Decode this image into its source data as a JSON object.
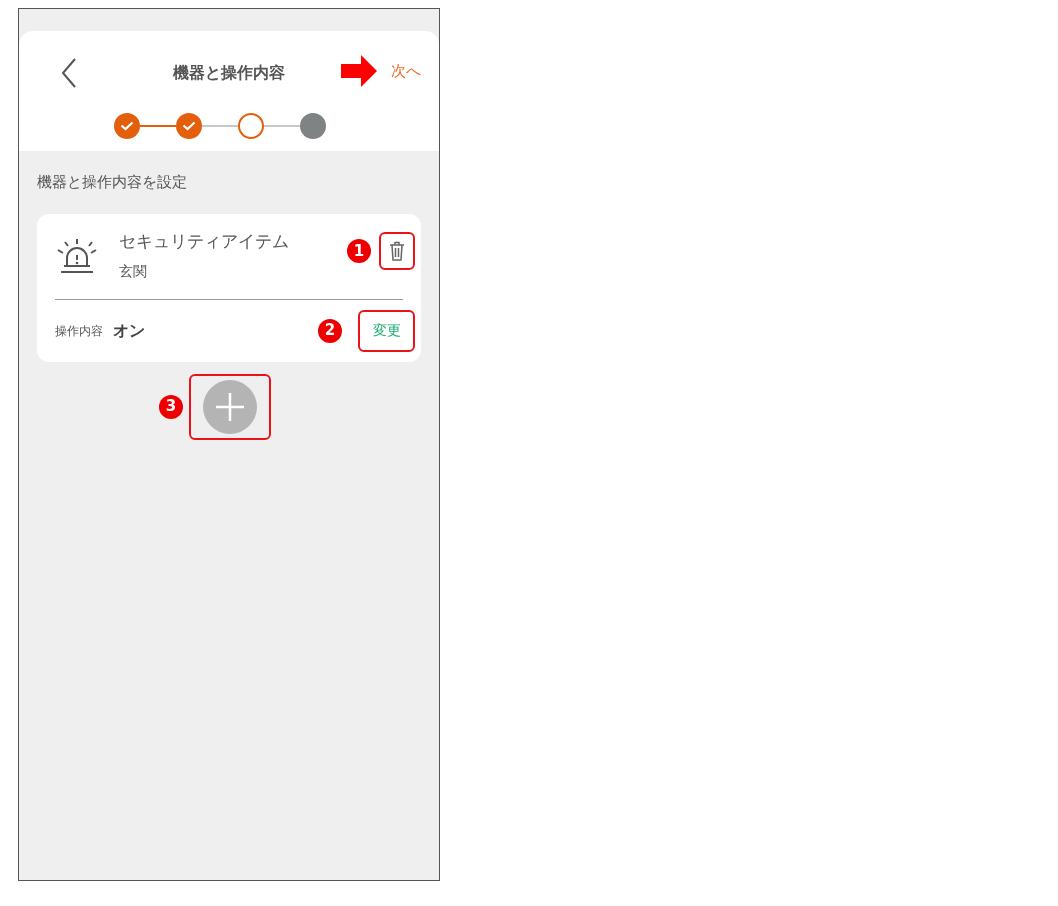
{
  "header": {
    "title": "機器と操作内容",
    "next_label": "次へ",
    "next_pointer": true
  },
  "steps": [
    {
      "completed": true,
      "selected": false
    },
    {
      "completed": true,
      "selected": false
    },
    {
      "completed": false,
      "selected": true
    },
    {
      "completed": false,
      "selected": false
    }
  ],
  "section_label": "機器と操作内容を設定",
  "device_card": {
    "name": "セキュリティアイテム",
    "location": "玄関",
    "delete_callout": "1",
    "action_label": "操作内容",
    "action_value": "オン",
    "change_label": "変更",
    "change_callout": "2"
  },
  "add_button": {
    "callout": "3"
  }
}
